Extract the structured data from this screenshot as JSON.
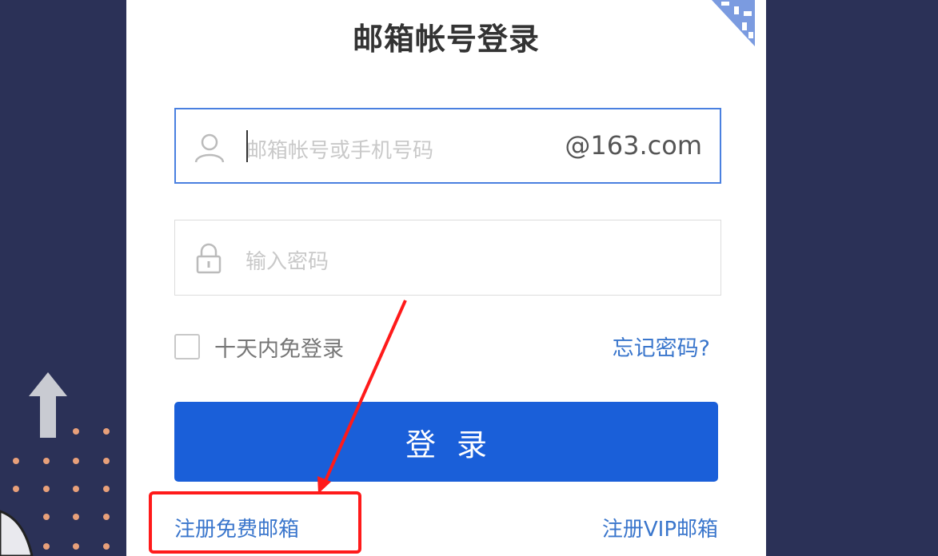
{
  "login": {
    "title": "邮箱帐号登录",
    "account_placeholder": "邮箱帐号或手机号码",
    "domain_suffix": "@163.com",
    "password_placeholder": "输入密码",
    "remember_label": "十天内免登录",
    "forgot_label": "忘记密码?",
    "submit_label": "登录",
    "register_free_label": "注册免费邮箱",
    "register_vip_label": "注册VIP邮箱"
  },
  "colors": {
    "background": "#2b3157",
    "primary_button": "#1a5fd9",
    "link": "#3a76cc",
    "annotation": "#ff1a1a"
  },
  "icons": [
    "user-icon",
    "lock-icon",
    "qr-code-icon",
    "arrow-up-icon"
  ]
}
